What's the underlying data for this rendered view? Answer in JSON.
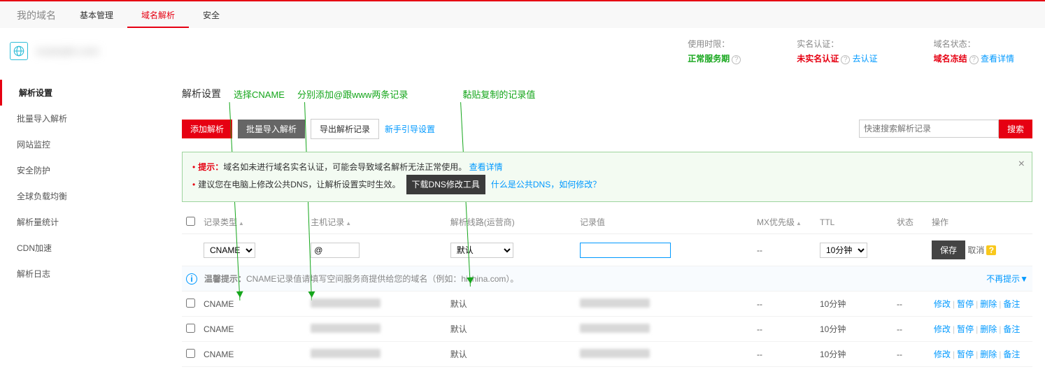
{
  "brand": "我的域名",
  "topTabs": [
    "基本管理",
    "域名解析",
    "安全"
  ],
  "activeTopTab": 1,
  "domainName": "example.com",
  "status": {
    "usage": {
      "label": "使用时限：",
      "value": "正常服务期"
    },
    "realname": {
      "label": "实名认证：",
      "value": "未实名认证",
      "action": "去认证"
    },
    "domstat": {
      "label": "域名状态：",
      "value": "域名冻结",
      "action": "查看详情"
    }
  },
  "sidebar": [
    "解析设置",
    "批量导入解析",
    "网站监控",
    "安全防护",
    "全球负载均衡",
    "解析量统计",
    "CDN加速",
    "解析日志"
  ],
  "activeSidebar": 0,
  "sectionTitle": "解析设置",
  "annotations": {
    "cname": "选择CNAME",
    "records": "分别添加@跟www两条记录",
    "paste": "黏贴复制的记录值"
  },
  "toolbar": {
    "add": "添加解析",
    "import": "批量导入解析",
    "export": "导出解析记录",
    "guide": "新手引导设置",
    "searchPlaceholder": "快速搜索解析记录",
    "search": "搜索"
  },
  "alert": {
    "hintLabel": "提示：",
    "hintText": "域名如未进行域名实名认证，可能会导致域名解析无法正常使用。",
    "hintLink": "查看详情",
    "sugText": "建议您在电脑上修改公共DNS，让解析设置实时生效。",
    "dnsBtn": "下载DNS修改工具",
    "dnsLink": "什么是公共DNS，如何修改？"
  },
  "columns": {
    "type": "记录类型",
    "host": "主机记录",
    "line": "解析线路(运营商)",
    "value": "记录值",
    "mx": "MX优先级",
    "ttl": "TTL",
    "state": "状态",
    "ops": "操作"
  },
  "editRow": {
    "typeOption": "CNAME",
    "hostValue": "@",
    "lineOption": "默认",
    "ttlOption": "10分钟",
    "mx": "--",
    "save": "保存",
    "cancel": "取消"
  },
  "hint": {
    "label": "温馨提示：",
    "text": "CNAME记录值请填写空间服务商提供给您的域名（例如：hichina.com）。",
    "noshow": "不再提示"
  },
  "rows": [
    {
      "type": "CNAME",
      "line": "默认",
      "mx": "--",
      "ttl": "10分钟",
      "state": "--"
    },
    {
      "type": "CNAME",
      "line": "默认",
      "mx": "--",
      "ttl": "10分钟",
      "state": "--"
    },
    {
      "type": "CNAME",
      "line": "默认",
      "mx": "--",
      "ttl": "10分钟",
      "state": "--"
    }
  ],
  "rowOps": {
    "edit": "修改",
    "pause": "暂停",
    "delete": "删除",
    "note": "备注"
  },
  "noShowArrow": "不再提示▼"
}
